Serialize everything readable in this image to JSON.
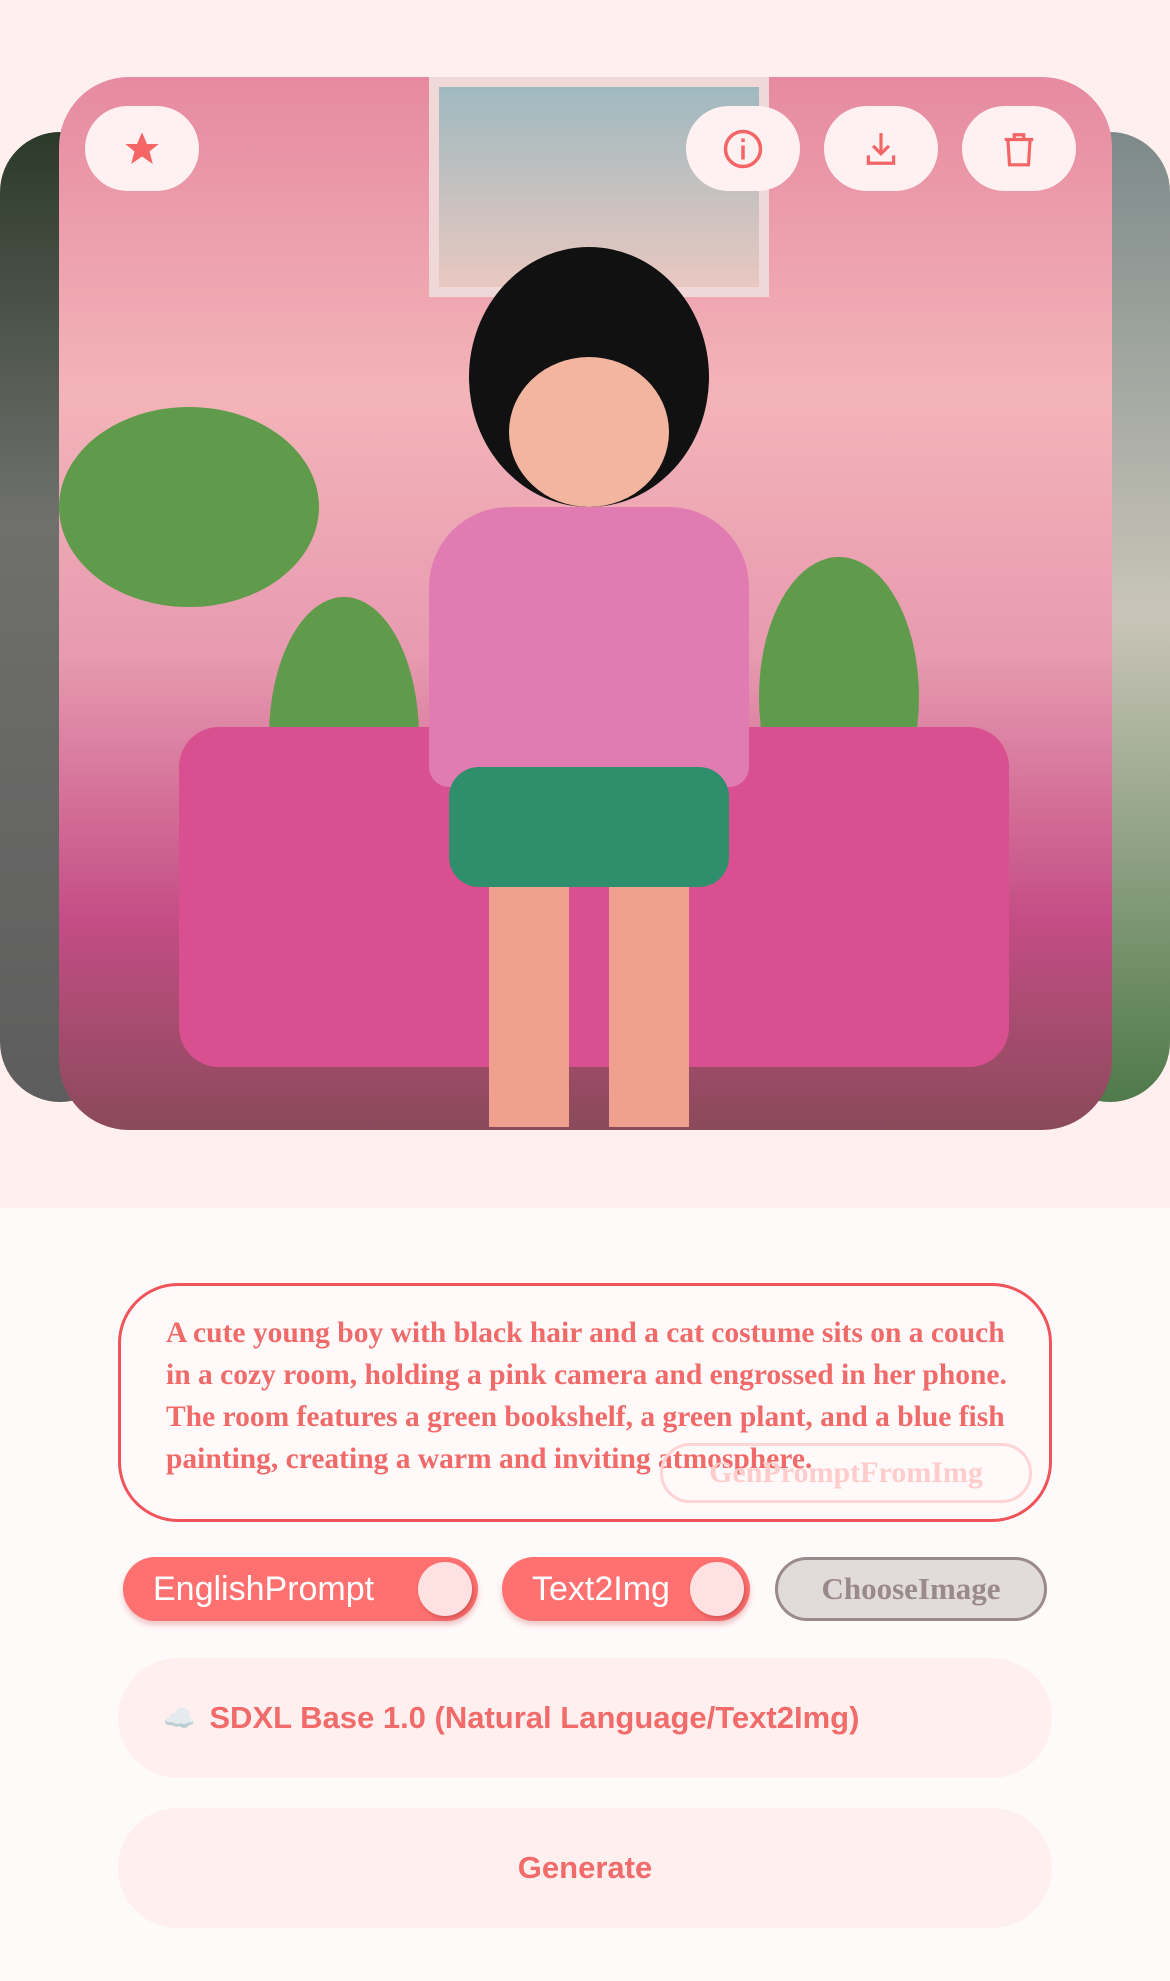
{
  "image_actions": {
    "favorite_icon": "star-icon",
    "info_icon": "info-icon",
    "download_icon": "download-icon",
    "delete_icon": "trash-icon"
  },
  "prompt": {
    "text": "A cute young boy with black hair and a cat costume sits on a couch in a cozy room, holding a pink camera and engrossed in her phone. The room features a green bookshelf, a green plant, and a blue fish painting, creating a warm and inviting atmosphere.",
    "gen_prompt_button": "GenPromptFromImg"
  },
  "toggles": {
    "english_prompt": "EnglishPrompt",
    "text2img": "Text2Img",
    "choose_image": "ChooseImage"
  },
  "model": {
    "icon": "☁️",
    "label": "SDXL Base 1.0 (Natural Language/Text2Img)"
  },
  "generate_label": "Generate",
  "colors": {
    "accent": "#ff7171",
    "background": "#fff0ef"
  }
}
